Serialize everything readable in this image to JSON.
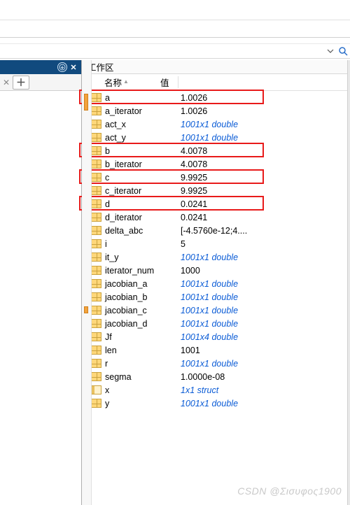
{
  "panel": {
    "title": "工作区"
  },
  "columns": {
    "name": "名称",
    "value": "值"
  },
  "rows": [
    {
      "icon": "array",
      "name": "a",
      "value": "1.0026",
      "link": false,
      "hl": true
    },
    {
      "icon": "array",
      "name": "a_iterator",
      "value": "1.0026",
      "link": false,
      "hl": false
    },
    {
      "icon": "array",
      "name": "act_x",
      "value": "1001x1 double",
      "link": true,
      "hl": false
    },
    {
      "icon": "array",
      "name": "act_y",
      "value": "1001x1 double",
      "link": true,
      "hl": false
    },
    {
      "icon": "array",
      "name": "b",
      "value": "4.0078",
      "link": false,
      "hl": true
    },
    {
      "icon": "array",
      "name": "b_iterator",
      "value": "4.0078",
      "link": false,
      "hl": false
    },
    {
      "icon": "array",
      "name": "c",
      "value": "9.9925",
      "link": false,
      "hl": true
    },
    {
      "icon": "array",
      "name": "c_iterator",
      "value": "9.9925",
      "link": false,
      "hl": false
    },
    {
      "icon": "array",
      "name": "d",
      "value": "0.0241",
      "link": false,
      "hl": true
    },
    {
      "icon": "array",
      "name": "d_iterator",
      "value": "0.0241",
      "link": false,
      "hl": false
    },
    {
      "icon": "array",
      "name": "delta_abc",
      "value": "[-4.5760e-12;4....",
      "link": false,
      "hl": false
    },
    {
      "icon": "array",
      "name": "i",
      "value": "5",
      "link": false,
      "hl": false
    },
    {
      "icon": "array",
      "name": "it_y",
      "value": "1001x1 double",
      "link": true,
      "hl": false
    },
    {
      "icon": "array",
      "name": "iterator_num",
      "value": "1000",
      "link": false,
      "hl": false
    },
    {
      "icon": "array",
      "name": "jacobian_a",
      "value": "1001x1 double",
      "link": true,
      "hl": false
    },
    {
      "icon": "array",
      "name": "jacobian_b",
      "value": "1001x1 double",
      "link": true,
      "hl": false
    },
    {
      "icon": "array",
      "name": "jacobian_c",
      "value": "1001x1 double",
      "link": true,
      "hl": false
    },
    {
      "icon": "array",
      "name": "jacobian_d",
      "value": "1001x1 double",
      "link": true,
      "hl": false
    },
    {
      "icon": "array",
      "name": "Jf",
      "value": "1001x4 double",
      "link": true,
      "hl": false
    },
    {
      "icon": "array",
      "name": "len",
      "value": "1001",
      "link": false,
      "hl": false
    },
    {
      "icon": "array",
      "name": "r",
      "value": "1001x1 double",
      "link": true,
      "hl": false
    },
    {
      "icon": "array",
      "name": "segma",
      "value": "1.0000e-08",
      "link": false,
      "hl": false
    },
    {
      "icon": "struct",
      "name": "x",
      "value": "1x1 struct",
      "link": true,
      "hl": false
    },
    {
      "icon": "array",
      "name": "y",
      "value": "1001x1 double",
      "link": true,
      "hl": false
    }
  ],
  "watermark": "CSDN @Σισυφος1900"
}
